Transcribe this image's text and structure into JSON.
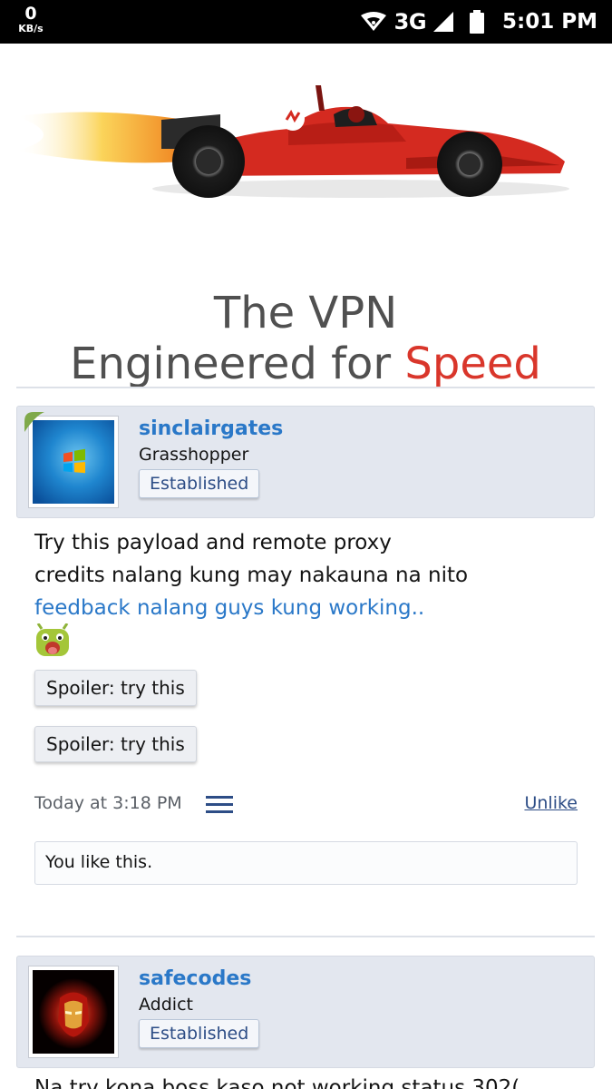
{
  "status_bar": {
    "speed_value": "0",
    "speed_unit": "KB/s",
    "network": "3G",
    "time": "5:01 PM"
  },
  "ad": {
    "line1": "The VPN",
    "line2_prefix": "Engineered for ",
    "line2_highlight": "Speed"
  },
  "posts": [
    {
      "username": "sinclairgates",
      "user_title": "Grasshopper",
      "badge": "Established",
      "message_lines": [
        "Try this payload and remote proxy",
        "credits nalang kung may nakauna na nito"
      ],
      "message_link": "feedback nalang guys kung working..",
      "spoilers": [
        "Spoiler: try this",
        "Spoiler: try this"
      ],
      "date": "Today at 3:18 PM",
      "unlike_label": "Unlike",
      "likes_text": "You like this."
    },
    {
      "username": "safecodes",
      "user_title": "Addict",
      "badge": "Established",
      "message_partial": "Na try kona boss kaso not working status 302("
    }
  ],
  "colors": {
    "link": "#2a78c8",
    "accent_dark": "#2d4d86",
    "brand_red": "#d9362b",
    "header_bg": "#e3e7ef"
  }
}
